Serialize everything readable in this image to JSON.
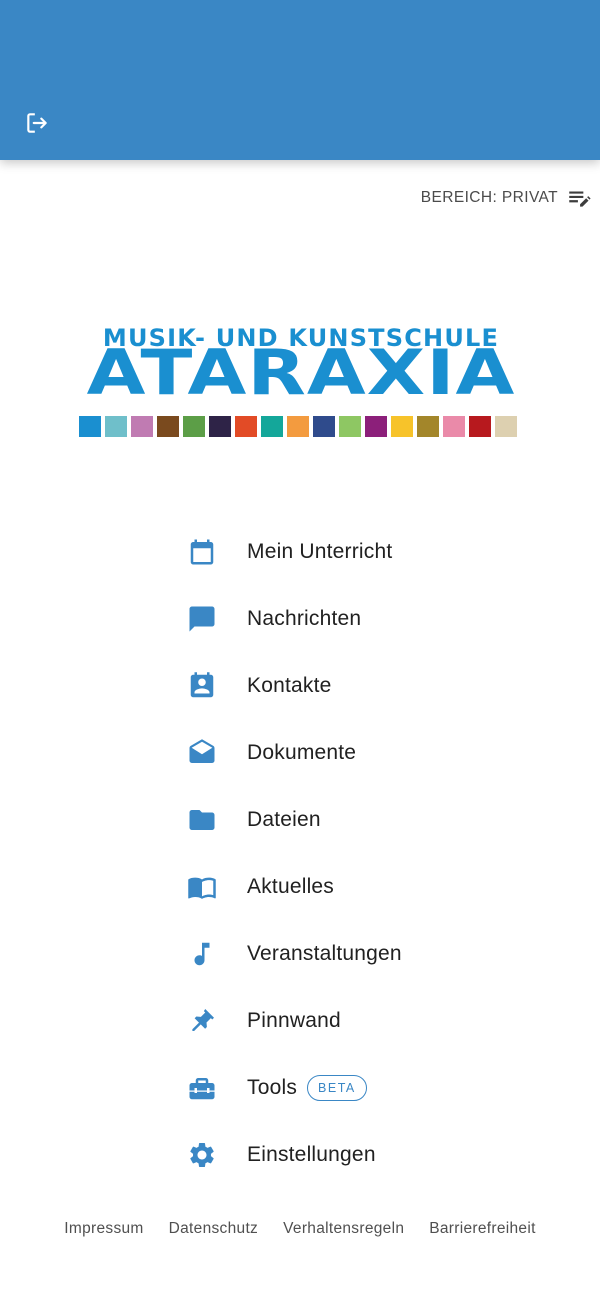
{
  "header": {
    "color": "#3a87c5",
    "logout_icon": "logout-icon"
  },
  "area": {
    "label": "BEREICH: PRIVAT",
    "icon": "edit-list-icon"
  },
  "logo": {
    "subtitle": "MUSIK- UND KUNSTSCHULE",
    "name": "ATARAXIA",
    "color": "#1a8fd0",
    "swatches": [
      "#1a8fd0",
      "#6fbfca",
      "#c07bb2",
      "#7a4a1e",
      "#5c9e47",
      "#2e2347",
      "#e24b26",
      "#14a79a",
      "#f39b3f",
      "#2f4b8c",
      "#8ec763",
      "#8c1f7a",
      "#f7c32a",
      "#a3862a",
      "#ea8aa9",
      "#b7191e",
      "#ddd0b0"
    ]
  },
  "menu": {
    "accent": "#3a87c5",
    "items": [
      {
        "label": "Mein Unterricht",
        "icon": "calendar-icon"
      },
      {
        "label": "Nachrichten",
        "icon": "chat-icon"
      },
      {
        "label": "Kontakte",
        "icon": "contacts-icon"
      },
      {
        "label": "Dokumente",
        "icon": "open-envelope-icon"
      },
      {
        "label": "Dateien",
        "icon": "folder-icon"
      },
      {
        "label": "Aktuelles",
        "icon": "book-icon"
      },
      {
        "label": "Veranstaltungen",
        "icon": "music-note-icon"
      },
      {
        "label": "Pinnwand",
        "icon": "pin-icon"
      },
      {
        "label": "Tools",
        "icon": "toolbox-icon",
        "badge": "BETA"
      },
      {
        "label": "Einstellungen",
        "icon": "gear-icon"
      }
    ]
  },
  "footer": {
    "links": [
      "Impressum",
      "Datenschutz",
      "Verhaltensregeln",
      "Barrierefreiheit"
    ]
  }
}
